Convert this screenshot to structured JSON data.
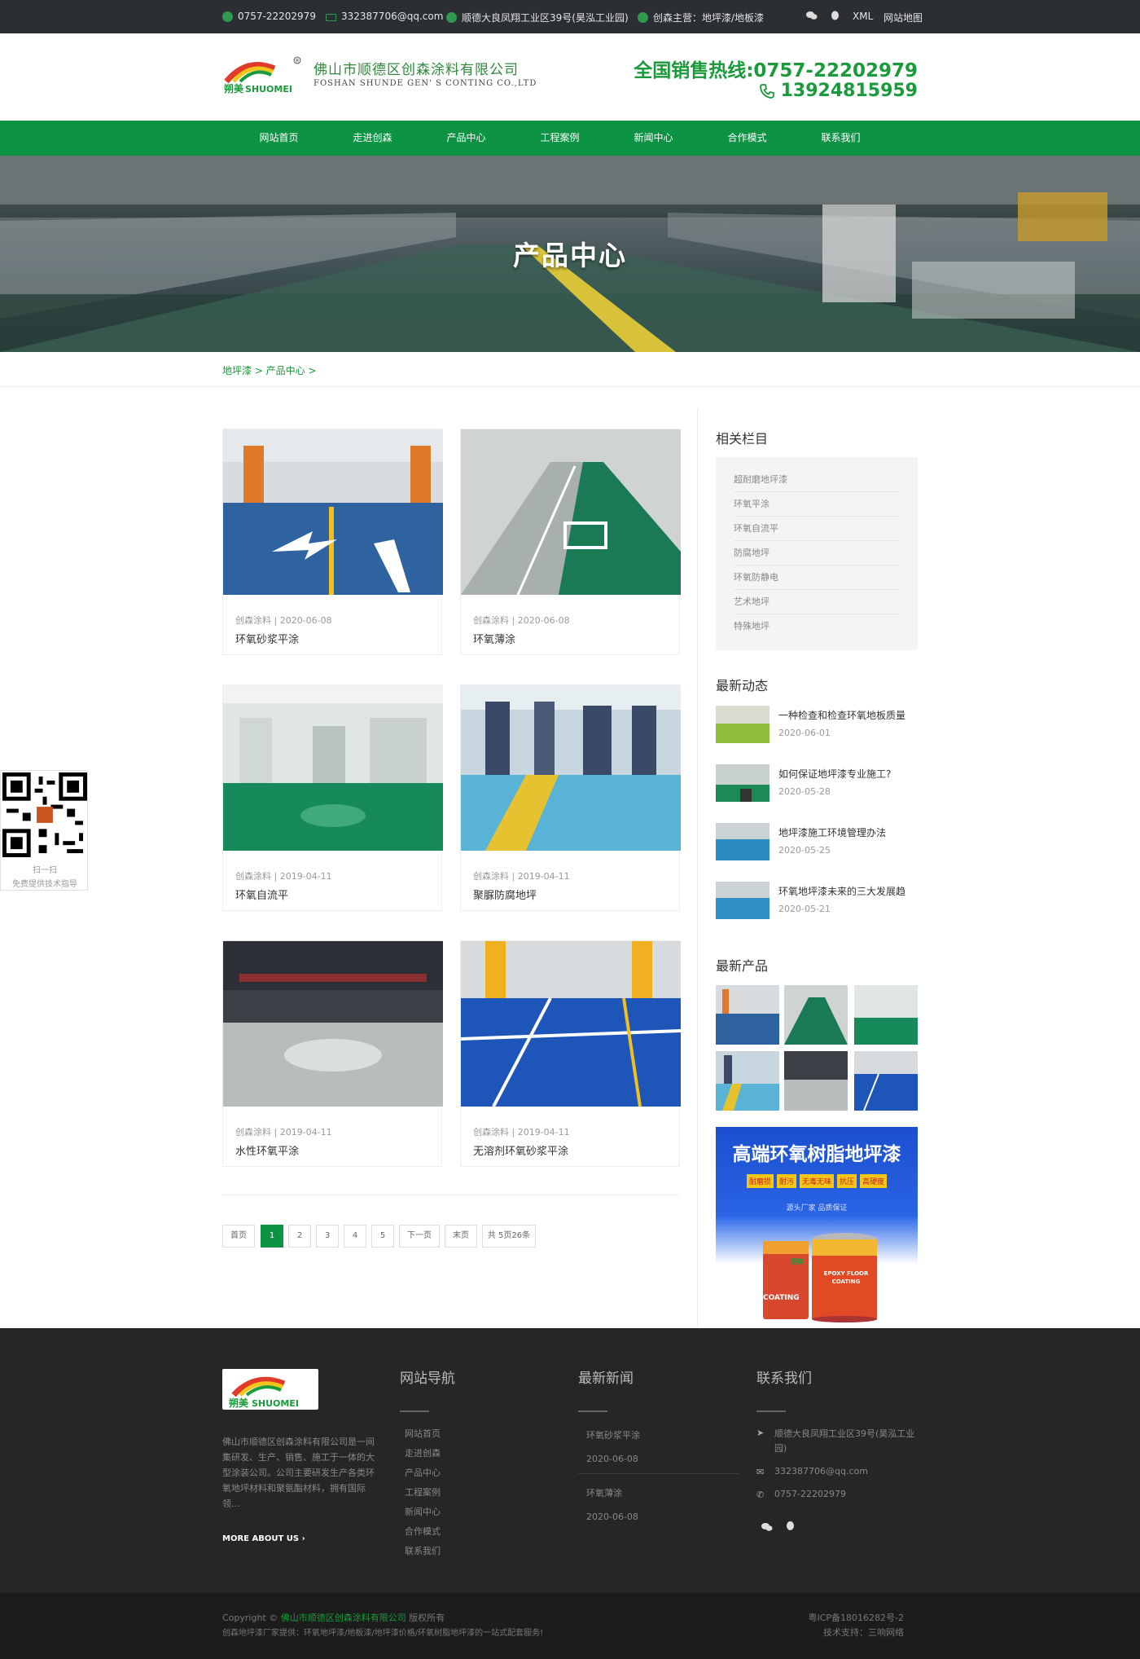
{
  "topbar": {
    "phone": "0757-22202979",
    "email": "332387706@qq.com",
    "address": "顺德大良凤翔工业区39号(昊泓工业园)",
    "business": "创森主营：地坪漆/地板漆",
    "xml": "XML",
    "sitemap": "网站地图"
  },
  "header": {
    "logo_text": "朔美 SHUOMEI",
    "company_name": "佛山市顺德区创森涂料有限公司",
    "company_en": "FOSHAN SHUNDE GEN' S CONTING CO.,LTD",
    "hotline": "全国销售热线:0757-22202979",
    "mobile": "13924815959"
  },
  "nav": [
    "网站首页",
    "走进创森",
    "产品中心",
    "工程案例",
    "新闻中心",
    "合作模式",
    "联系我们"
  ],
  "banner": {
    "title": "产品中心"
  },
  "breadcrumb": "地坪漆 > 产品中心 >",
  "products": [
    {
      "meta": "创森涂料 | 2020-06-08",
      "name": "环氧砂浆平涂",
      "scene": "blue-parking"
    },
    {
      "meta": "创森涂料 | 2020-06-08",
      "name": "环氧薄涂",
      "scene": "green-parking"
    },
    {
      "meta": "创森涂料 | 2019-04-11",
      "name": "环氧自流平",
      "scene": "green-room"
    },
    {
      "meta": "创森涂料 | 2019-04-11",
      "name": "聚脲防腐地坪",
      "scene": "factory-blue"
    },
    {
      "meta": "创森涂料 | 2019-04-11",
      "name": "水性环氧平涂",
      "scene": "warehouse-grey"
    },
    {
      "meta": "创森涂料 | 2019-04-11",
      "name": "无溶剂环氧砂浆平涂",
      "scene": "blue-lines"
    }
  ],
  "pagination": {
    "first": "首页",
    "pages": [
      "1",
      "2",
      "3",
      "4",
      "5"
    ],
    "current": "1",
    "next": "下一页",
    "last": "末页",
    "total": "共 5页26条"
  },
  "sidebar": {
    "categories_title": "相关栏目",
    "categories": [
      "超耐磨地坪漆",
      "环氧平涂",
      "环氧自流平",
      "防腐地坪",
      "环氧防静电",
      "艺术地坪",
      "特殊地坪"
    ],
    "news_title": "最新动态",
    "news": [
      {
        "title": "一种检查和检查环氧地板质量",
        "date": "2020-06-01"
      },
      {
        "title": "如何保证地坪漆专业施工?",
        "date": "2020-05-28"
      },
      {
        "title": "地坪漆施工环境管理办法",
        "date": "2020-05-25"
      },
      {
        "title": "环氧地坪漆未来的三大发展趋",
        "date": "2020-05-21"
      }
    ],
    "products_title": "最新产品",
    "ad": {
      "title": "高端环氧树脂地坪漆",
      "tags": [
        "耐磨损",
        "耐污",
        "无毒无味",
        "抗压",
        "高硬度"
      ],
      "slogan": "源头厂家 品质保证",
      "can_brand": "朔美",
      "can_label": "EPOXY FLOOR COATING",
      "can_text": "COATING"
    }
  },
  "qr": {
    "scan": "扫一扫",
    "desc": "免费提供技术指导"
  },
  "footer": {
    "about": "佛山市顺德区创森涂料有限公司是一间集研发、生产、销售、施工于一体的大型涂装公司。公司主要研发生产各类环氧地坪材料和聚氨酯材料，拥有国际领...",
    "more": "MORE ABOUT US",
    "nav_title": "网站导航",
    "nav_items": [
      "网站首页",
      "走进创森",
      "产品中心",
      "工程案例",
      "新闻中心",
      "合作模式",
      "联系我们"
    ],
    "news_title": "最新新闻",
    "news": [
      {
        "title": "环氧砂浆平涂",
        "date": "2020-06-08"
      },
      {
        "title": "环氧薄涂",
        "date": "2020-06-08"
      }
    ],
    "contact_title": "联系我们",
    "address": "顺德大良凤翔工业区39号(昊泓工业园)",
    "email": "332387706@qq.com",
    "phone": "0757-22202979"
  },
  "copyright": {
    "prefix": "Copyright ©",
    "company": "佛山市顺德区创森涂料有限公司",
    "suffix": "版权所有",
    "line2": "创森地坪漆厂家提供：环氧地坪漆/地板漆/地坪漆价格/环氧树脂地坪漆的一站式配套服务!",
    "icp": "粤ICP备18016282号-2",
    "support": "技术支持：三响网络"
  },
  "colors": {
    "brand_green": "#0c9344",
    "topbar": "#2b2e33",
    "footer": "#262626"
  }
}
